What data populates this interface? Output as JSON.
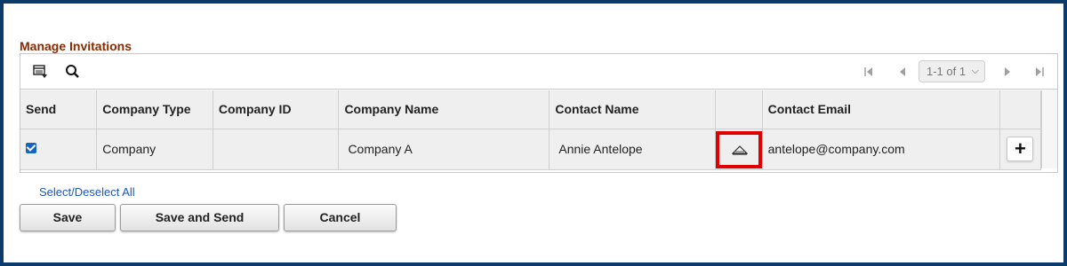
{
  "section": {
    "title": "Manage Invitations"
  },
  "toolbar": {
    "icons": [
      "grid-personalize-icon",
      "search-icon"
    ],
    "pager": {
      "first_icon": "first-page-icon",
      "prev_icon": "previous-page-icon",
      "next_icon": "next-page-icon",
      "last_icon": "last-page-icon",
      "range_label": "1-1 of 1"
    }
  },
  "table": {
    "columns": [
      "Send",
      "Company Type",
      "Company ID",
      "Company Name",
      "Contact Name",
      "",
      "Contact Email",
      ""
    ],
    "rows": [
      {
        "send_checked": true,
        "company_type": "Company",
        "company_id": "",
        "company_name": "Company A",
        "contact_name": "Annie Antelope",
        "lookup_icon": "lookup-icon",
        "contact_email": "antelope@company.com",
        "add_icon": "plus-icon"
      }
    ]
  },
  "links": {
    "select_deselect": "Select/Deselect All"
  },
  "buttons": {
    "save": "Save",
    "save_and_send": "Save and Send",
    "cancel": "Cancel"
  },
  "colors": {
    "title": "#8a2a00",
    "link": "#1a57c2",
    "checkbox": "#1565c0",
    "highlight": "#e00000",
    "frame": "#0b3a6b"
  }
}
